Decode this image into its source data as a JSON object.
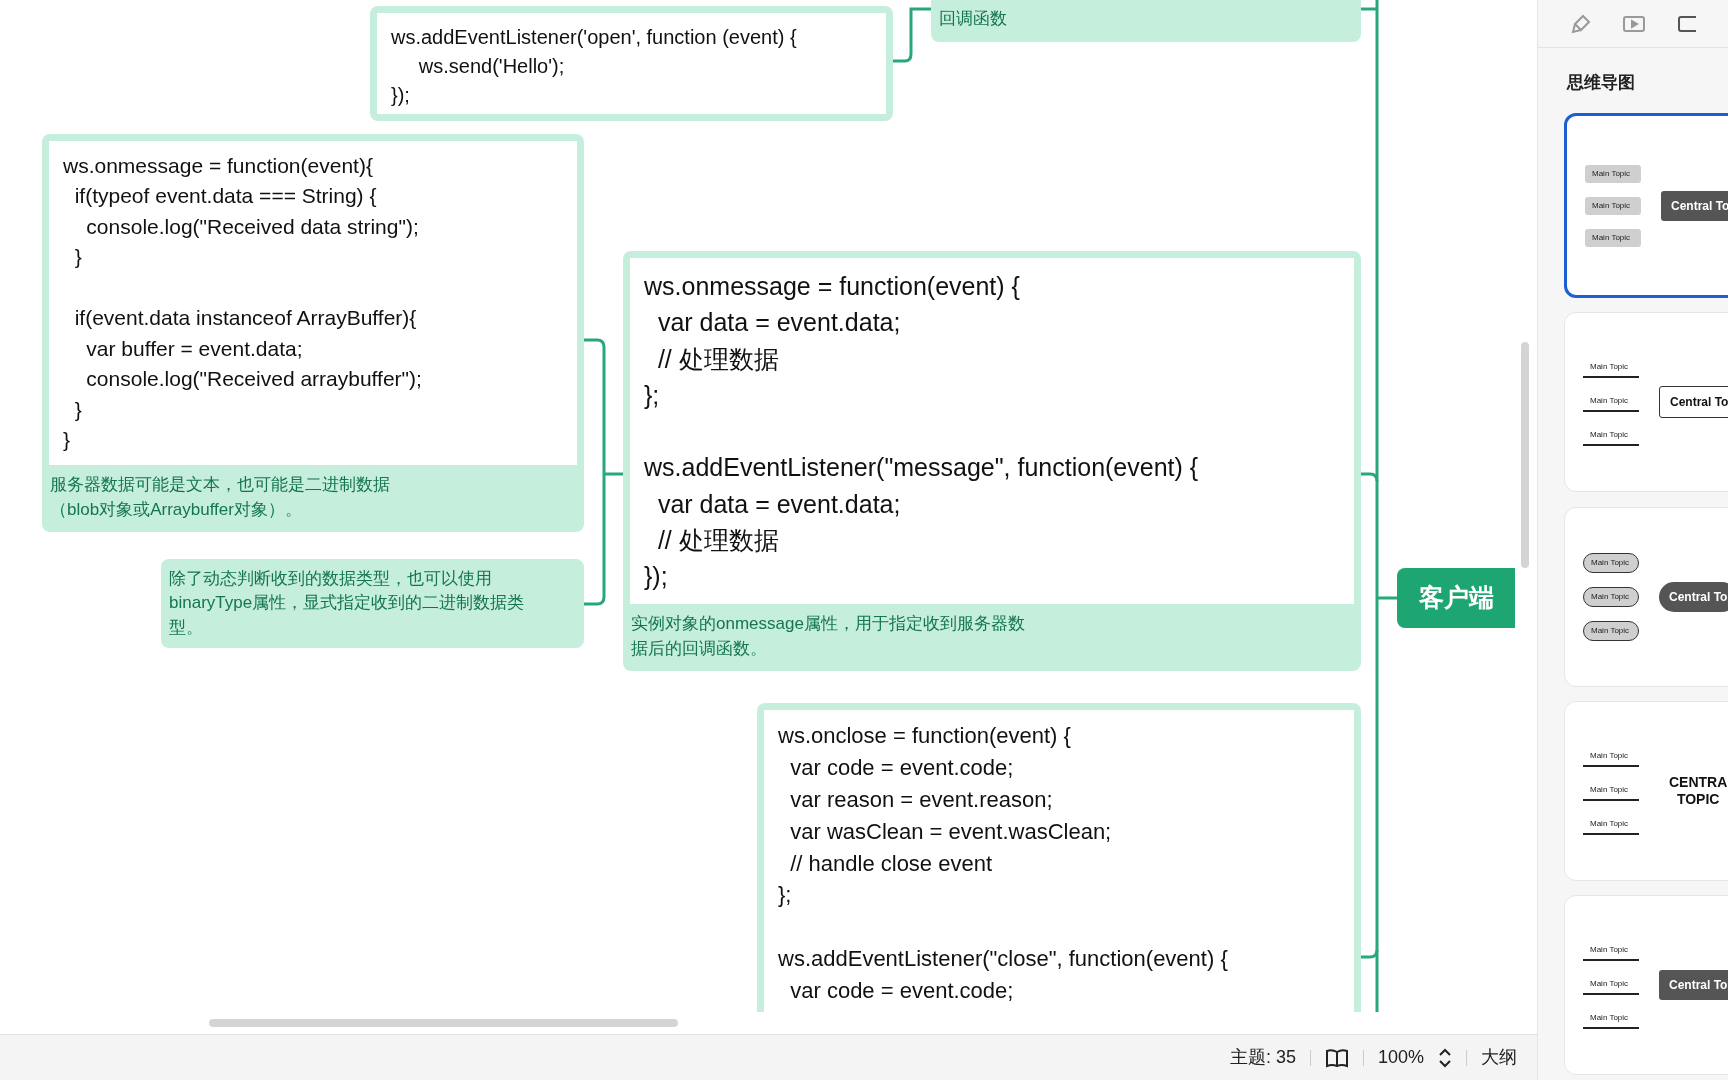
{
  "canvas": {
    "nodes": [
      {
        "kind": "code",
        "code": "ws.addEventListener('open', function (event) {\n     ws.send('Hello');\n});"
      },
      {
        "kind": "note",
        "text": "回调函数"
      },
      {
        "kind": "code",
        "code": "ws.onmessage = function(event){\n  if(typeof event.data === String) {\n    console.log(\"Received data string\");\n  }\n\n  if(event.data instanceof ArrayBuffer){\n    var buffer = event.data;\n    console.log(\"Received arraybuffer\");\n  }\n}",
        "note": "服务器数据可能是文本，也可能是二进制数据（blob对象或Arraybuffer对象）。"
      },
      {
        "kind": "note",
        "text": "除了动态判断收到的数据类型，也可以使用binaryType属性，显式指定收到的二进制数据类型。"
      },
      {
        "kind": "code",
        "code": "ws.onmessage = function(event) {\n  var data = event.data;\n  // 处理数据\n};\n\nws.addEventListener(\"message\", function(event) {\n  var data = event.data;\n  // 处理数据\n});",
        "note": "实例对象的onmessage属性，用于指定收到服务器数据后的回调函数。"
      },
      {
        "kind": "code",
        "code": "ws.onclose = function(event) {\n  var code = event.code;\n  var reason = event.reason;\n  var wasClean = event.wasClean;\n  // handle close event\n};\n\nws.addEventListener(\"close\", function(event) {\n  var code = event.code;"
      }
    ],
    "central_topic": "客户端"
  },
  "side_panel": {
    "title": "思维导图",
    "styles": [
      {
        "kind": "boxed",
        "selected": true,
        "topics": [
          "Main Topic",
          "Main Topic",
          "Main Topic"
        ],
        "central": "Central To"
      },
      {
        "kind": "underline",
        "selected": false,
        "topics": [
          "Main Topic",
          "Main Topic",
          "Main Topic"
        ],
        "central": "Central To"
      },
      {
        "kind": "pill",
        "selected": false,
        "topics": [
          "Main Topic",
          "Main Topic",
          "Main Topic"
        ],
        "central": "Central To"
      },
      {
        "kind": "bracket",
        "selected": false,
        "topics": [
          "Main Topic",
          "Main Topic",
          "Main Topic"
        ],
        "central": "CENTRA\nTOPIC"
      },
      {
        "kind": "tree",
        "selected": false,
        "topics": [
          "Main Topic",
          "Main Topic",
          "Main Topic"
        ],
        "central": "Central To"
      }
    ]
  },
  "status_bar": {
    "topic_count": "主题: 35",
    "zoom": "100%",
    "outline": "大纲"
  }
}
